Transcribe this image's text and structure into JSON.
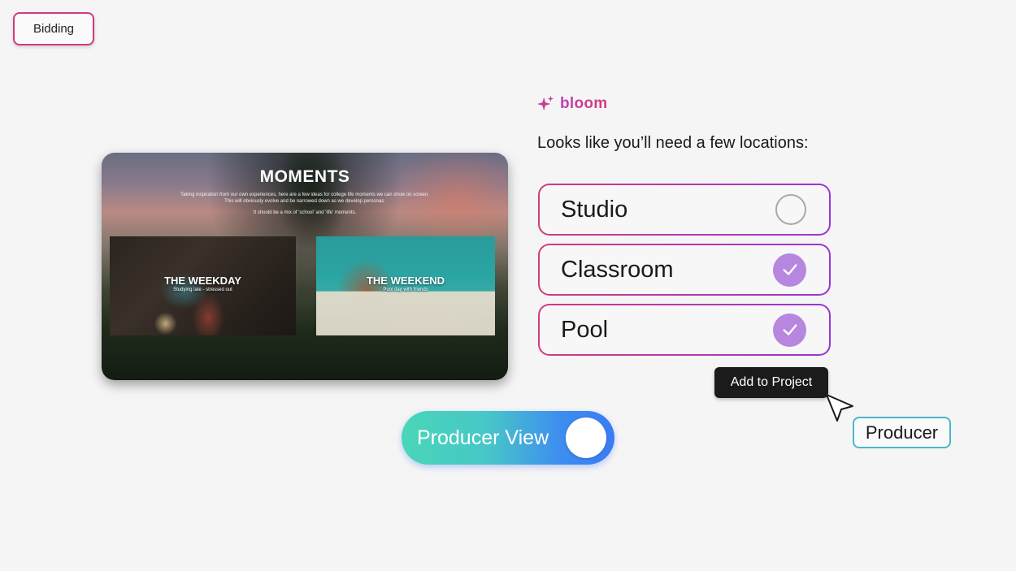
{
  "bidding_tag": {
    "label": "Bidding"
  },
  "slide": {
    "title": "MOMENTS",
    "description": "Taking inspiration from our own experiences, here are a few ideas for college life moments we can show on screen. This will obviously evolve and be narrowed down as we develop personas.",
    "note": "It should be a mix of 'school' and 'life' moments.",
    "tiles": [
      {
        "heading": "THE WEEKDAY",
        "subtitle": "Studying late - stressed out"
      },
      {
        "heading": "THE WEEKEND",
        "subtitle": "Pool day with friends"
      }
    ]
  },
  "bloom": {
    "brand": "bloom",
    "icon": "sparkle-icon",
    "message": "Looks like you’ll need a few locations:"
  },
  "locations": [
    {
      "label": "Studio",
      "checked": false
    },
    {
      "label": "Classroom",
      "checked": true
    },
    {
      "label": "Pool",
      "checked": true
    }
  ],
  "add_to_project": {
    "label": "Add to Project"
  },
  "producer_tag": {
    "label": "Producer"
  },
  "producer_toggle": {
    "label": "Producer View",
    "on": true
  },
  "colors": {
    "border_gradient_start": "#d23b7e",
    "border_gradient_end": "#9a35d6",
    "check_fill": "#b787e0",
    "toggle_gradient_start": "#49d6b8",
    "toggle_gradient_end": "#3b7bf5",
    "producer_tag_border": "#4cb7c7"
  }
}
